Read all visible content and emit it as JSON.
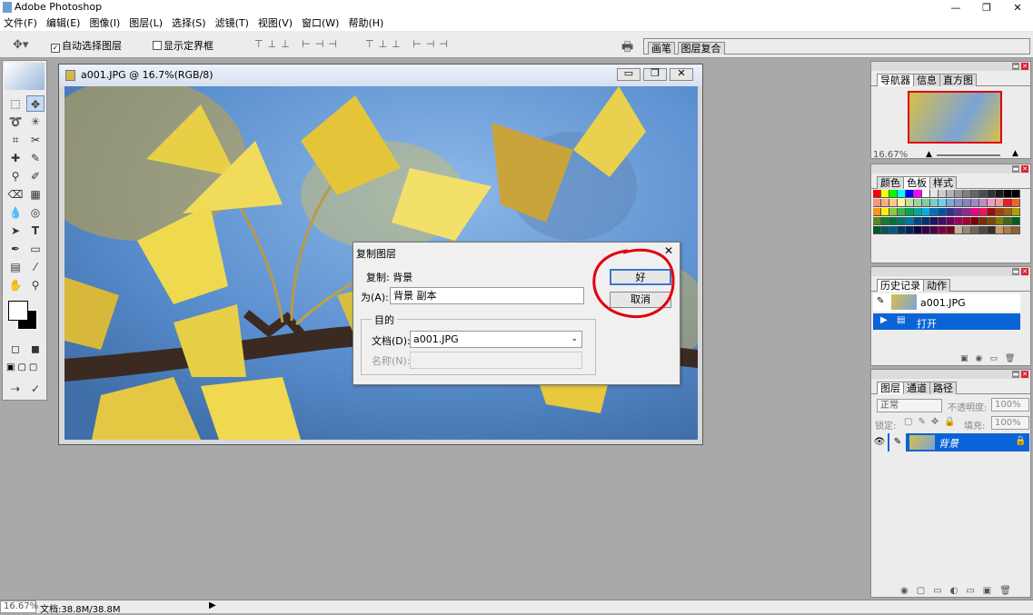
{
  "app": {
    "title": "Adobe Photoshop"
  },
  "window_controls": {
    "minimize": "—",
    "maximize": "❐",
    "close": "✕"
  },
  "menu": [
    "文件(F)",
    "编辑(E)",
    "图像(I)",
    "图层(L)",
    "选择(S)",
    "滤镜(T)",
    "视图(V)",
    "窗口(W)",
    "帮助(H)"
  ],
  "options": {
    "auto_select": "自动选择图层",
    "show_bounds": "显示定界框",
    "auto_select_checked": true,
    "show_bounds_checked": false
  },
  "well": {
    "brushes": "画笔",
    "layer_comps": "图层复合"
  },
  "document": {
    "title": "a001.JPG @ 16.7%(RGB/8)"
  },
  "dialog": {
    "title": "复制图层",
    "duplicate_label": "复制: 背景",
    "as_label": "为(A):",
    "as_value": "背景 副本",
    "dest_group": "目的",
    "doc_label": "文档(D):",
    "doc_value": "a001.JPG",
    "name_label": "名称(N):",
    "ok": "好",
    "cancel": "取消",
    "close": "✕"
  },
  "navigator": {
    "tabs": [
      "导航器",
      "信息",
      "直方图"
    ],
    "zoom": "16.67%"
  },
  "swatches": {
    "tabs": [
      "颜色",
      "色板",
      "样式"
    ]
  },
  "history": {
    "tabs": [
      "历史记录",
      "动作"
    ],
    "snapshot": "a001.JPG",
    "items": [
      "打开"
    ]
  },
  "layers": {
    "tabs": [
      "图层",
      "通道",
      "路径"
    ],
    "blend_mode": "正常",
    "opacity_label": "不透明度:",
    "opacity": "100%",
    "lock_label": "锁定:",
    "fill_label": "填充:",
    "fill": "100%",
    "layer_name": "背景"
  },
  "status": {
    "zoom": "16.67%",
    "doc": "文档:38.8M/38.8M"
  },
  "colors": {
    "highlight": "#0a64d7",
    "annotation": "#e0000f"
  }
}
